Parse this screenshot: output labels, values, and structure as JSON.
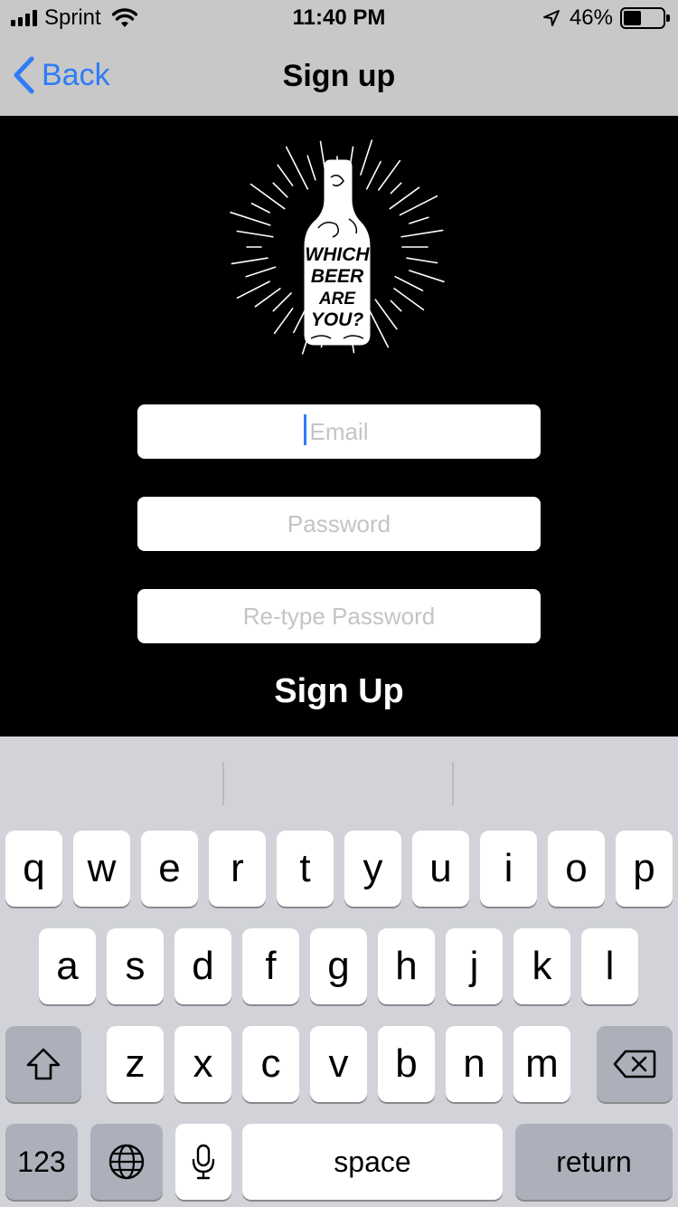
{
  "status_bar": {
    "carrier": "Sprint",
    "time": "11:40 PM",
    "battery_percent": "46%",
    "battery_level": 0.46,
    "signal_bars": 4,
    "icons": [
      "signal-icon",
      "wifi-icon",
      "location-arrow-icon",
      "battery-icon"
    ]
  },
  "nav": {
    "back_label": "Back",
    "title": "Sign up",
    "accent_color": "#2e7cf6"
  },
  "logo": {
    "text_lines": [
      "WHICH",
      "BEER",
      "ARE",
      "YOU?"
    ],
    "icon": "beer-bottle-sunburst-logo"
  },
  "form": {
    "email_placeholder": "Email",
    "email_value": "",
    "password_placeholder": "Password",
    "password_value": "",
    "retype_placeholder": "Re-type Password",
    "retype_value": "",
    "submit_label": "Sign Up"
  },
  "keyboard": {
    "row1": [
      "q",
      "w",
      "e",
      "r",
      "t",
      "y",
      "u",
      "i",
      "o",
      "p"
    ],
    "row2": [
      "a",
      "s",
      "d",
      "f",
      "g",
      "h",
      "j",
      "k",
      "l"
    ],
    "row3": [
      "z",
      "x",
      "c",
      "v",
      "b",
      "n",
      "m"
    ],
    "numbers_label": "123",
    "space_label": "space",
    "return_label": "return",
    "icons": [
      "shift-icon",
      "backspace-icon",
      "globe-icon",
      "microphone-icon"
    ]
  }
}
